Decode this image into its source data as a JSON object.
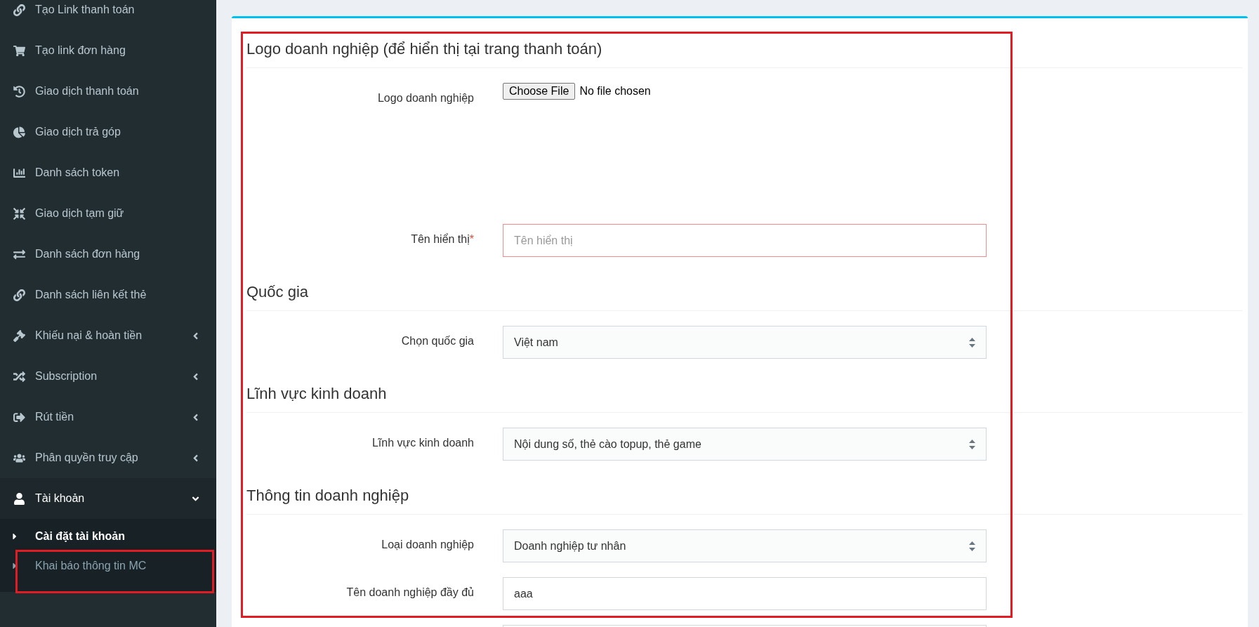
{
  "sidebar": {
    "items": [
      {
        "label": "Tạo Link thanh toán",
        "has_children": false,
        "expanded": false
      },
      {
        "label": "Tạo link đơn hàng",
        "has_children": false,
        "expanded": false
      },
      {
        "label": "Giao dịch thanh toán",
        "has_children": false,
        "expanded": false
      },
      {
        "label": "Giao dịch trả góp",
        "has_children": false,
        "expanded": false
      },
      {
        "label": "Danh sách token",
        "has_children": false,
        "expanded": false
      },
      {
        "label": "Giao dịch tạm giữ",
        "has_children": false,
        "expanded": false
      },
      {
        "label": "Danh sách đơn hàng",
        "has_children": false,
        "expanded": false
      },
      {
        "label": "Danh sách liên kết thẻ",
        "has_children": false,
        "expanded": false
      },
      {
        "label": "Khiếu nại & hoàn tiền",
        "has_children": true,
        "expanded": false
      },
      {
        "label": "Subscription",
        "has_children": true,
        "expanded": false
      },
      {
        "label": "Rút tiền",
        "has_children": true,
        "expanded": false
      },
      {
        "label": "Phân quyền truy cập",
        "has_children": true,
        "expanded": false
      },
      {
        "label": "Tài khoản",
        "has_children": true,
        "expanded": true,
        "children": [
          {
            "label": "Cài đặt tài khoản",
            "selected": true,
            "highlighted": false
          },
          {
            "label": "Khai báo thông tin MC",
            "selected": false,
            "highlighted": true
          }
        ]
      }
    ]
  },
  "form": {
    "highlighted": true,
    "sections": [
      {
        "title": "Logo doanh nghiệp (để hiển thị tại trang thanh toán)",
        "fields": [
          {
            "kind": "file",
            "label": "Logo doanh nghiệp",
            "button": "Choose File",
            "value": "No file chosen"
          },
          {
            "kind": "text",
            "label": "Tên hiển thị",
            "required_mark": "*",
            "invalid": true,
            "placeholder": "Tên hiển thị"
          }
        ]
      },
      {
        "title": "Quốc gia",
        "fields": [
          {
            "kind": "select",
            "label": "Chọn quốc gia",
            "value": "Việt nam"
          }
        ]
      },
      {
        "title": "Lĩnh vực kinh doanh",
        "fields": [
          {
            "kind": "select",
            "label": "Lĩnh vực kinh doanh",
            "value": "Nội dung số, thẻ cào topup, thẻ game"
          }
        ]
      },
      {
        "title": "Thông tin doanh nghiệp",
        "fields": [
          {
            "kind": "select",
            "label": "Loại doanh nghiệp",
            "value": "Doanh nghiệp tư nhân"
          },
          {
            "kind": "text",
            "label": "Tên doanh nghiệp đầy đủ",
            "value": "aaa"
          },
          {
            "kind": "text"
          }
        ]
      }
    ]
  }
}
